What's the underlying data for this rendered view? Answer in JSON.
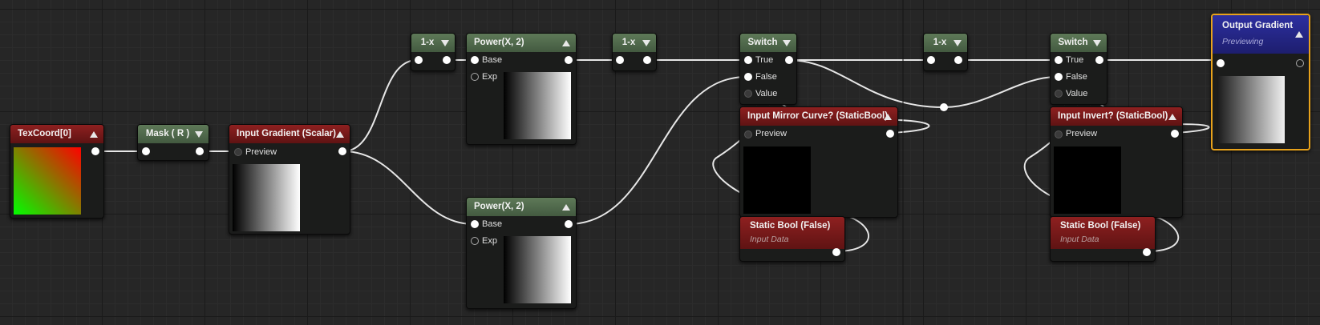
{
  "colors": {
    "wire": "#e6e6e6",
    "header_green": "#4f6a4a",
    "header_red": "#7a1a1a",
    "header_blue": "#24258a",
    "selection": "#e8a21b"
  },
  "nodes": {
    "texcoord": {
      "title": "TexCoord[0]"
    },
    "mask": {
      "title": "Mask ( R )"
    },
    "input_gradient": {
      "title": "Input Gradient (Scalar)",
      "preview_label": "Preview"
    },
    "one_minus_1": {
      "title": "1-x"
    },
    "power_top": {
      "title": "Power(X, 2)",
      "base_label": "Base",
      "exp_label": "Exp"
    },
    "one_minus_2": {
      "title": "1-x"
    },
    "power_bottom": {
      "title": "Power(X, 2)",
      "base_label": "Base",
      "exp_label": "Exp"
    },
    "switch_1": {
      "title": "Switch",
      "true_label": "True",
      "false_label": "False",
      "value_label": "Value"
    },
    "mirror_param": {
      "title": "Input Mirror Curve? (StaticBool)",
      "preview_label": "Preview"
    },
    "static_bool_1": {
      "title": "Static Bool (False)",
      "subtitle": "Input Data"
    },
    "one_minus_3": {
      "title": "1-x"
    },
    "switch_2": {
      "title": "Switch",
      "true_label": "True",
      "false_label": "False",
      "value_label": "Value"
    },
    "invert_param": {
      "title": "Input Invert? (StaticBool)",
      "preview_label": "Preview"
    },
    "static_bool_2": {
      "title": "Static Bool (False)",
      "subtitle": "Input Data"
    },
    "output": {
      "title": "Output Gradient",
      "subtitle": "Previewing"
    }
  }
}
